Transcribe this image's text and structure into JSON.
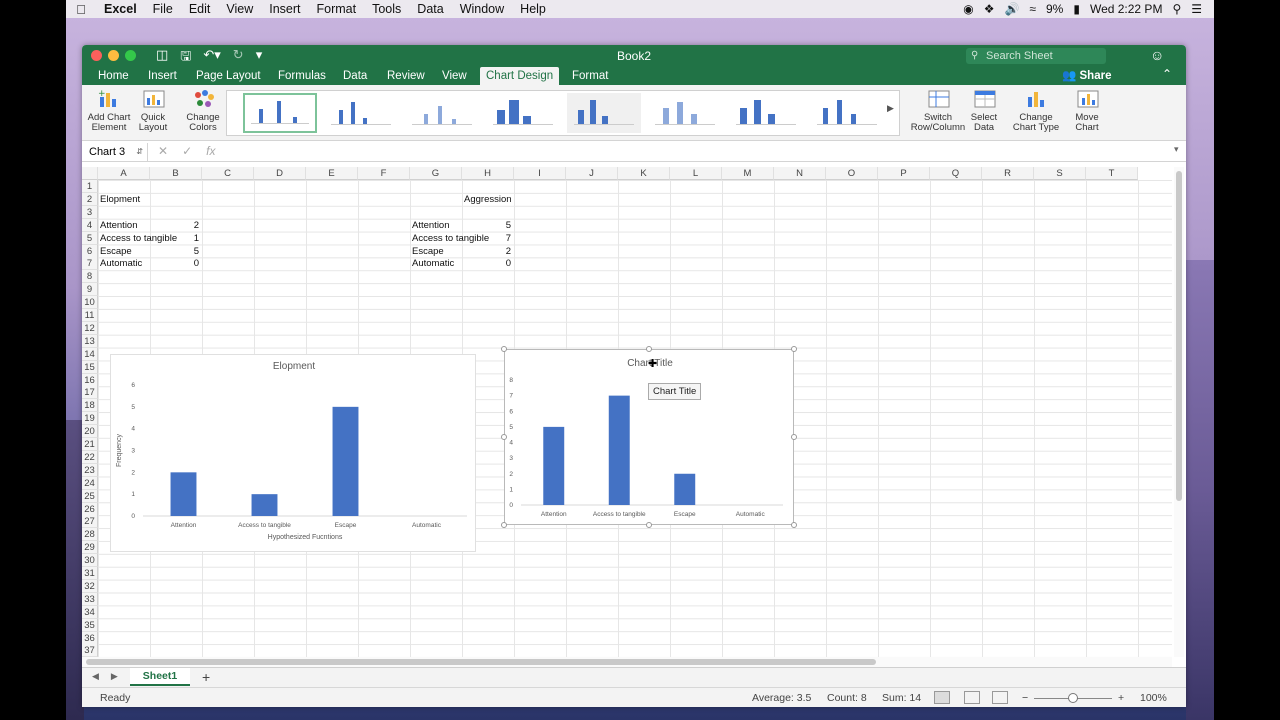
{
  "menubar": {
    "app": "Excel",
    "items": [
      "File",
      "Edit",
      "View",
      "Insert",
      "Format",
      "Tools",
      "Data",
      "Window",
      "Help"
    ],
    "battery": "9%",
    "clock": "Wed 2:22 PM"
  },
  "window": {
    "title": "Book2",
    "search_placeholder": "Search Sheet",
    "share": "Share"
  },
  "tabs": [
    "Home",
    "Insert",
    "Page Layout",
    "Formulas",
    "Data",
    "Review",
    "View",
    "Chart Design",
    "Format"
  ],
  "active_tab": "Chart Design",
  "ribbon": {
    "add_chart_element": [
      "Add Chart",
      "Element"
    ],
    "quick_layout": [
      "Quick",
      "Layout"
    ],
    "change_colors": [
      "Change",
      "Colors"
    ],
    "switch_row_column": [
      "Switch",
      "Row/Column"
    ],
    "select_data": [
      "Select",
      "Data"
    ],
    "change_chart_type": [
      "Change",
      "Chart Type"
    ],
    "move_chart": [
      "Move",
      "Chart"
    ]
  },
  "formula_bar": {
    "name_box": "Chart 3",
    "fx": "fx"
  },
  "columns": [
    "A",
    "B",
    "C",
    "D",
    "E",
    "F",
    "G",
    "H",
    "I",
    "J",
    "K",
    "L",
    "M",
    "N",
    "O",
    "P",
    "Q",
    "R",
    "S",
    "T"
  ],
  "rows": [
    "1",
    "2",
    "3",
    "4",
    "5",
    "6",
    "7",
    "8",
    "9",
    "10",
    "11",
    "12",
    "13",
    "14",
    "15",
    "16",
    "17",
    "18",
    "19",
    "20",
    "21",
    "22",
    "23",
    "24",
    "25",
    "26",
    "27",
    "28",
    "29",
    "30",
    "31",
    "32",
    "33",
    "34",
    "35",
    "36",
    "37"
  ],
  "cells": {
    "A2": "Elopment",
    "A4": "Attention",
    "B4": "2",
    "A5": "Access to tangible",
    "B5": "1",
    "A6": "Escape",
    "B6": "5",
    "A7": "Automatic",
    "B7": "0",
    "H2": "Aggression",
    "G4": "Attention",
    "H4": "5",
    "G5": "Access to tangible",
    "H5": "7",
    "G6": "Escape",
    "H6": "2",
    "G7": "Automatic",
    "H7": "0"
  },
  "chart_data": [
    {
      "type": "bar",
      "title": "Elopment",
      "xlabel": "Hypothesized Fucntions",
      "ylabel": "Frequency",
      "categories": [
        "Attention",
        "Access to tangible",
        "Escape",
        "Automatic"
      ],
      "values": [
        2,
        1,
        5,
        0
      ],
      "ylim": [
        0,
        6
      ],
      "yticks": [
        "0",
        "1",
        "2",
        "3",
        "4",
        "5",
        "6"
      ],
      "color": "#4472c4"
    },
    {
      "type": "bar",
      "title": "Chart Title",
      "xlabel": "",
      "ylabel": "",
      "categories": [
        "Attention",
        "Access to tangible",
        "Escape",
        "Automatic"
      ],
      "values": [
        5,
        7,
        2,
        0
      ],
      "ylim": [
        0,
        8
      ],
      "yticks": [
        "0",
        "1",
        "2",
        "3",
        "4",
        "5",
        "6",
        "7",
        "8"
      ],
      "color": "#4472c4"
    }
  ],
  "tooltip": "Chart Title",
  "sheet": {
    "tab": "Sheet1",
    "add": "+"
  },
  "status": {
    "ready": "Ready",
    "average": "Average: 3.5",
    "count": "Count: 8",
    "sum": "Sum: 14",
    "zoom": "100%",
    "zoom_minus": "−",
    "zoom_plus": "+"
  }
}
